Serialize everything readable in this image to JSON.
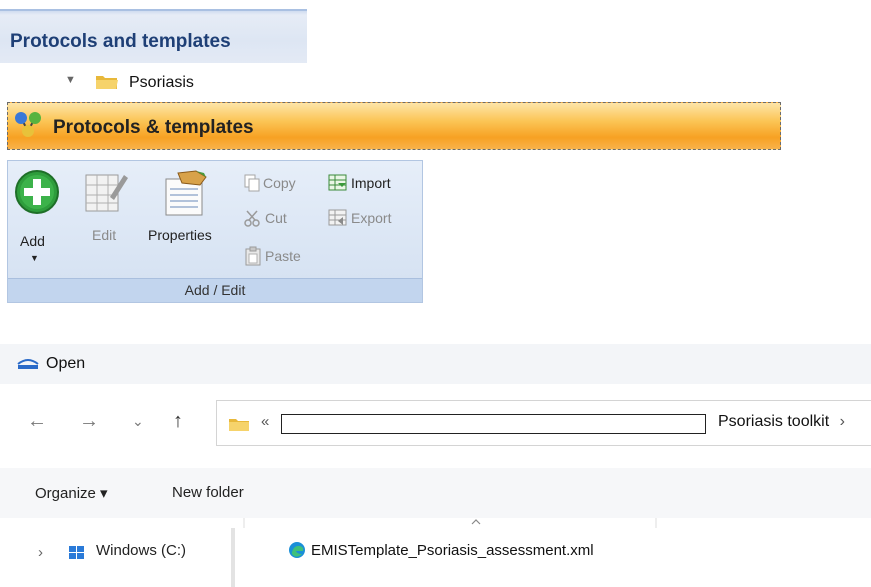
{
  "panel": {
    "section_title": "Protocols and templates",
    "tree_item": "Psoriasis"
  },
  "header_bar": {
    "title": "Protocols & templates"
  },
  "ribbon": {
    "add_label": "Add",
    "edit_label": "Edit",
    "properties_label": "Properties",
    "copy_label": "Copy",
    "cut_label": "Cut",
    "paste_label": "Paste",
    "import_label": "Import",
    "export_label": "Export",
    "group_label": "Add / Edit"
  },
  "open_dialog": {
    "title": "Open",
    "breadcrumb_overflow": "«",
    "breadcrumb_current": "Psoriasis toolkit",
    "breadcrumb_chevron": "›",
    "organize_label": "Organize ▾",
    "new_folder_label": "New folder",
    "drive_label": "Windows (C:)",
    "file_name": "EMISTemplate_Psoriasis_assessment.xml"
  },
  "icons": [
    "folder-icon",
    "protocols-icon",
    "add-icon",
    "edit-icon",
    "properties-icon",
    "copy-icon",
    "cut-icon",
    "paste-icon",
    "import-icon",
    "export-icon",
    "emis-icon",
    "back-icon",
    "forward-icon",
    "dropdown-icon",
    "up-icon",
    "drive-icon",
    "edge-icon"
  ],
  "colors": {
    "section_title": "#1e3f76",
    "orange_bar": "#f7a123",
    "ribbon_bg": "#dbe6f4"
  }
}
